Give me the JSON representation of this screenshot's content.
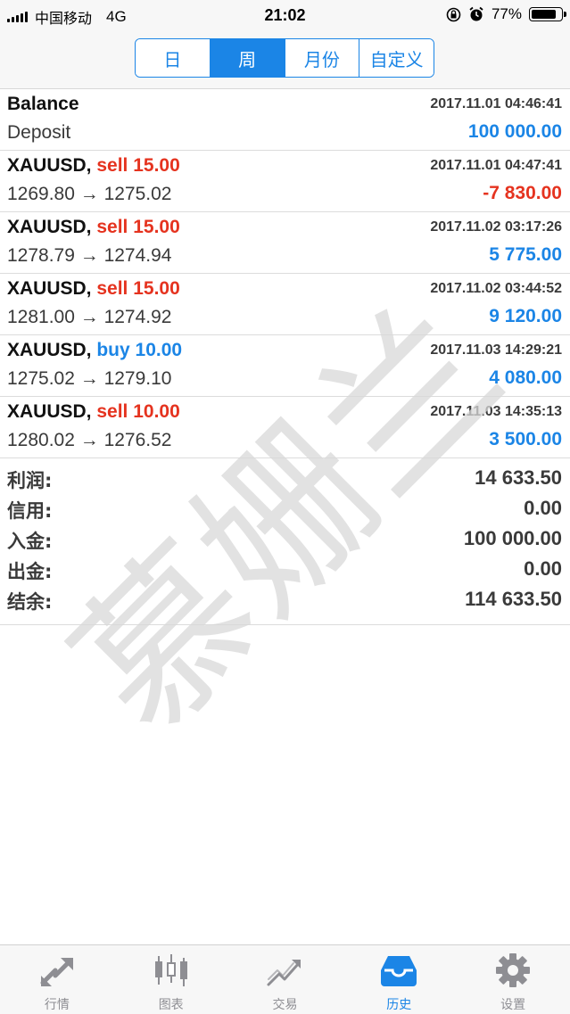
{
  "status_bar": {
    "carrier": "中国移动",
    "network": "4G",
    "time": "21:02",
    "battery": "77%"
  },
  "segments": [
    {
      "label": "日",
      "active": false
    },
    {
      "label": "周",
      "active": true
    },
    {
      "label": "月份",
      "active": false
    },
    {
      "label": "自定义",
      "active": false
    }
  ],
  "balance_row": {
    "title": "Balance",
    "date": "2017.11.01 04:46:41",
    "subtitle": "Deposit",
    "amount": "100 000.00"
  },
  "trades": [
    {
      "symbol": "XAUUSD,",
      "side": "sell 15.00",
      "date": "2017.11.01 04:47:41",
      "prices": "1269.80 → 1275.02",
      "profit": "-7 830.00"
    },
    {
      "symbol": "XAUUSD,",
      "side": "sell 15.00",
      "date": "2017.11.02 03:17:26",
      "prices": "1278.79 → 1274.94",
      "profit": "5 775.00"
    },
    {
      "symbol": "XAUUSD,",
      "side": "sell 15.00",
      "date": "2017.11.02 03:44:52",
      "prices": "1281.00 → 1274.92",
      "profit": "9 120.00"
    },
    {
      "symbol": "XAUUSD,",
      "side": "buy 10.00",
      "date": "2017.11.03 14:29:21",
      "prices": "1275.02 → 1279.10",
      "profit": "4 080.00"
    },
    {
      "symbol": "XAUUSD,",
      "side": "sell 10.00",
      "date": "2017.11.03 14:35:13",
      "prices": "1280.02 → 1276.52",
      "profit": "3 500.00"
    }
  ],
  "summary": [
    {
      "label": "利润:",
      "value": "14 633.50"
    },
    {
      "label": "信用:",
      "value": "0.00"
    },
    {
      "label": "入金:",
      "value": "100 000.00"
    },
    {
      "label": "出金:",
      "value": "0.00"
    },
    {
      "label": "结余:",
      "value": "114 633.50"
    }
  ],
  "watermark": "慕姗兰",
  "tabs": [
    {
      "label": "行情",
      "icon": "quotes-icon",
      "active": false
    },
    {
      "label": "图表",
      "icon": "candlestick-chart-icon",
      "active": false
    },
    {
      "label": "交易",
      "icon": "trade-icon",
      "active": false
    },
    {
      "label": "历史",
      "icon": "history-inbox-icon",
      "active": true
    },
    {
      "label": "设置",
      "icon": "gear-icon",
      "active": false
    }
  ],
  "colors": {
    "accent": "#1b85e6",
    "sell": "#e5331f",
    "buy": "#1b85e6",
    "profit_positive": "#1b85e6",
    "profit_negative": "#e5331f",
    "inactive": "#8e8e93"
  }
}
